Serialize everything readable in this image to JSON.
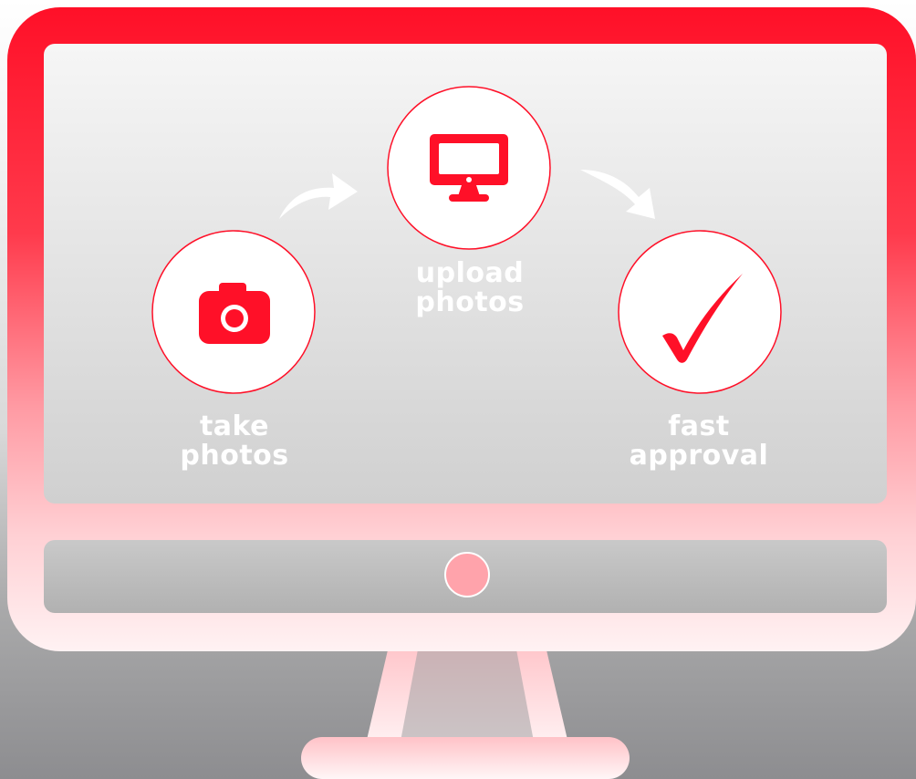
{
  "steps": [
    {
      "line1": "take",
      "line2": "photos",
      "icon": "camera-icon"
    },
    {
      "line1": "upload",
      "line2": "photos",
      "icon": "monitor-icon"
    },
    {
      "line1": "fast",
      "line2": "approval",
      "icon": "checkmark-icon"
    }
  ],
  "colors": {
    "accent": "#ff1028",
    "frame_light": "#ffffff",
    "screen": "#e6e6e6",
    "label": "#ffffff"
  }
}
